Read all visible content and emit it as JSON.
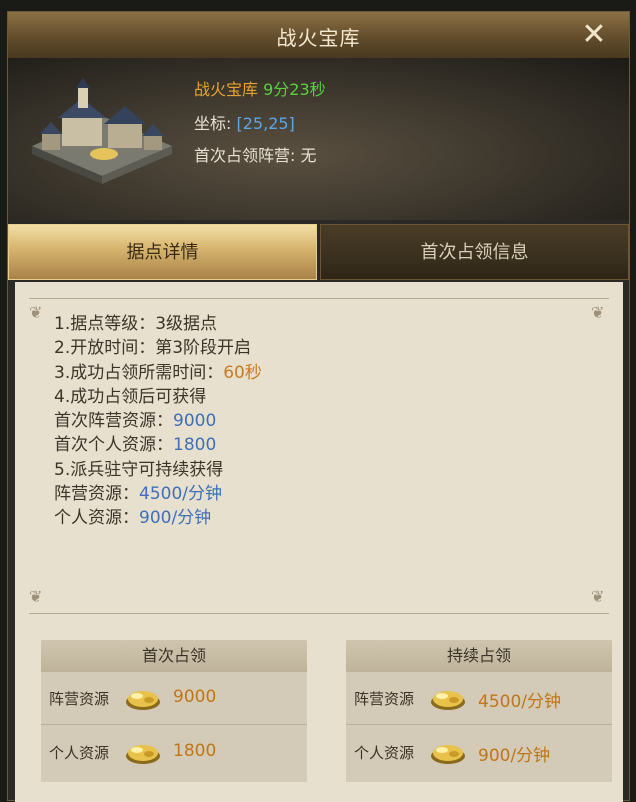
{
  "window": {
    "title": "战火宝库"
  },
  "info": {
    "name": "战火宝库",
    "timer": "9分23秒",
    "coord_label": "坐标:",
    "coord_value": "[25,25]",
    "first_faction_label": "首次占领阵营:",
    "first_faction_value": "无"
  },
  "tabs": [
    {
      "label": "据点详情",
      "active": true
    },
    {
      "label": "首次占领信息",
      "active": false
    }
  ],
  "details": {
    "lines": [
      {
        "text": "1.据点等级：3级据点",
        "value": ""
      },
      {
        "text": "2.开放时间：第3阶段开启",
        "value": ""
      },
      {
        "text": "3.成功占领所需时间：",
        "value": "60秒"
      },
      {
        "text": "4.成功占领后可获得",
        "value": ""
      },
      {
        "text": "首次阵营资源：",
        "value": "9000"
      },
      {
        "text": "首次个人资源：",
        "value": "1800"
      },
      {
        "text": "5.派兵驻守可持续获得",
        "value": ""
      },
      {
        "text": "阵营资源：",
        "value": "4500/分钟"
      },
      {
        "text": "个人资源：",
        "value": "900/分钟"
      }
    ]
  },
  "first_capture": {
    "title": "首次占领",
    "rows": [
      {
        "label": "阵营资源",
        "value": "9000"
      },
      {
        "label": "个人资源",
        "value": "1800"
      }
    ]
  },
  "continuous_capture": {
    "title": "持续占领",
    "rows": [
      {
        "label": "阵营资源",
        "value": "4500/分钟"
      },
      {
        "label": "个人资源",
        "value": "900/分钟"
      }
    ]
  },
  "icons": {
    "close": "close-icon",
    "resource": "gold-icon",
    "building": "treasury-building-icon"
  },
  "colors": {
    "accent_orange": "#e9a22c",
    "timer_green": "#56d33f",
    "coord_blue": "#5aa6e8",
    "value_blue": "#3e6fb8",
    "value_orange": "#c97b1f"
  }
}
